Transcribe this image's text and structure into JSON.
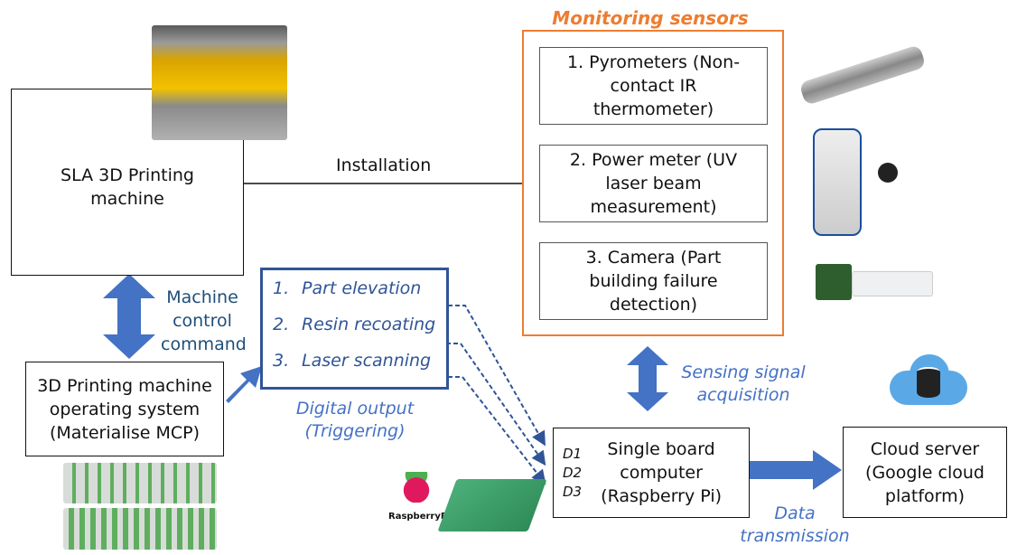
{
  "machine": {
    "label": "SLA 3D Printing machine"
  },
  "installation_label": "Installation",
  "monitoring": {
    "title": "Monitoring sensors",
    "sensors": [
      {
        "label": "1. Pyrometers (Non-contact IR thermometer)"
      },
      {
        "label": "2. Power meter (UV laser beam measurement)"
      },
      {
        "label": "3. Camera (Part building failure detection)"
      }
    ]
  },
  "machine_control_label": "Machine control command",
  "os_box": {
    "label": "3D Printing machine operating system (Materialise MCP)"
  },
  "digital_box": {
    "items": [
      {
        "num": "1.",
        "label": "Part elevation"
      },
      {
        "num": "2.",
        "label": "Resin recoating"
      },
      {
        "num": "3.",
        "label": "Laser scanning"
      }
    ]
  },
  "digital_output_label": "Digital output (Triggering)",
  "sensing_label": "Sensing signal acquisition",
  "sbc": {
    "pins": [
      "D1",
      "D2",
      "D3"
    ],
    "label": "Single board computer (Raspberry Pi)"
  },
  "raspberry_logo_text": "RaspberryPi",
  "data_transmission_label": "Data transmission",
  "cloud": {
    "label": "Cloud server (Google cloud platform)"
  },
  "colors": {
    "accent_blue": "#4472C4",
    "orange": "#ED7D31",
    "dark_blue": "#2F5597"
  }
}
